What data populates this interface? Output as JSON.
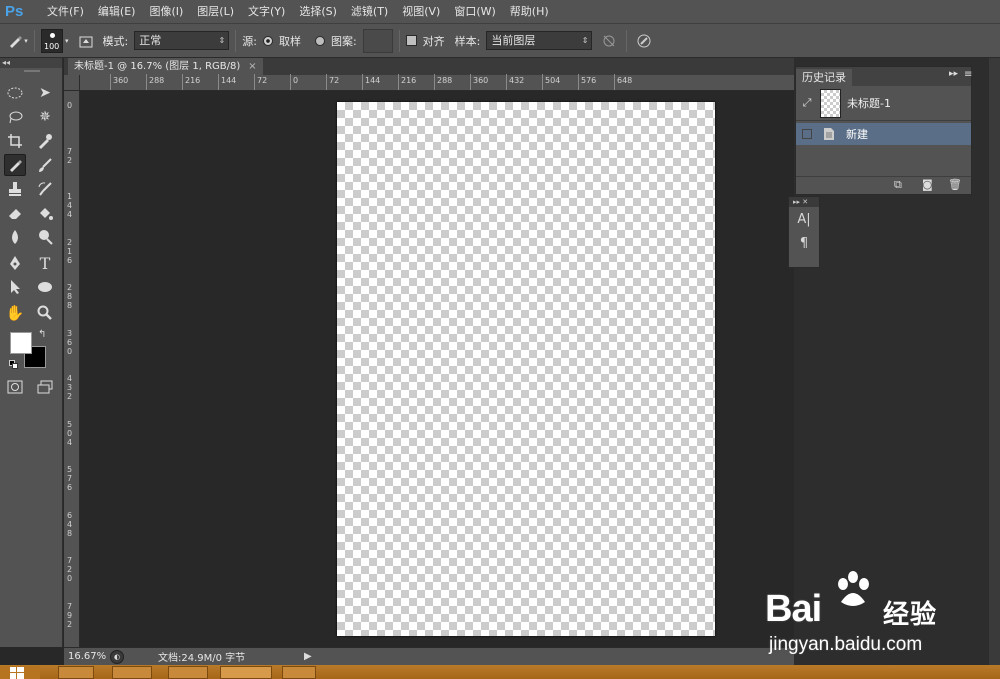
{
  "app": {
    "logo": "Ps"
  },
  "menu": [
    "文件(F)",
    "编辑(E)",
    "图像(I)",
    "图层(L)",
    "文字(Y)",
    "选择(S)",
    "滤镜(T)",
    "视图(V)",
    "窗口(W)",
    "帮助(H)"
  ],
  "options": {
    "brush_size": "100",
    "mode_label": "模式:",
    "mode_value": "正常",
    "source_label": "源:",
    "sampled_label": "取样",
    "pattern_label": "图案:",
    "aligned_label": "对齐",
    "sample_label": "样本:",
    "sample_value": "当前图层"
  },
  "document": {
    "tab_title": "未标题-1 @ 16.7% (图层 1, RGB/8)",
    "tab_close": "×",
    "zoom": "16.67%",
    "status": "文档:24.9M/0 字节"
  },
  "rulers": {
    "h_ticks": [
      "360",
      "288",
      "216",
      "144",
      "72",
      "0",
      "72",
      "144",
      "216",
      "288",
      "360",
      "432",
      "504",
      "576",
      "648"
    ],
    "v_ticks": [
      "0",
      "72",
      "144",
      "216",
      "288",
      "360",
      "432",
      "504",
      "576",
      "648",
      "720",
      "792"
    ]
  },
  "history": {
    "tab_label": "历史记录",
    "snapshot_label": "未标题-1",
    "state_label": "新建"
  },
  "watermark": {
    "brand": "Bai",
    "jingyan": "经验",
    "url": "jingyan.baidu.com"
  },
  "colors": {
    "foreground": "#ffffff",
    "background": "#000000",
    "selected_state": "#5b6e87"
  }
}
